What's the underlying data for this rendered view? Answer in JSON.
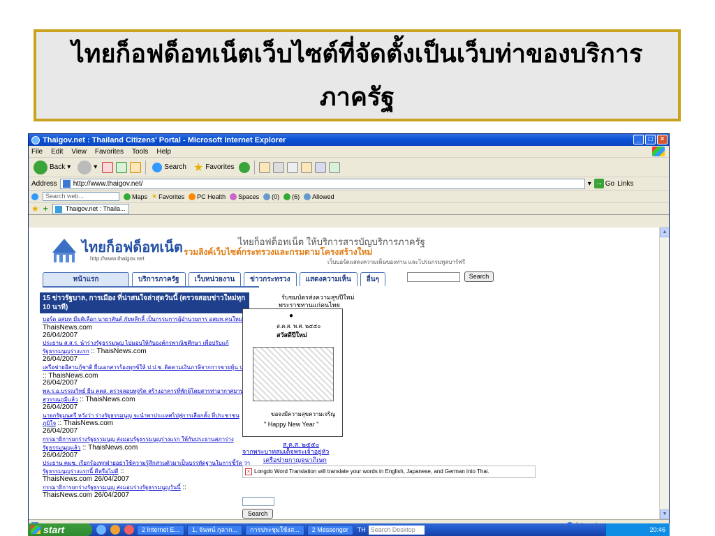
{
  "slide": {
    "title_line1": "ไทยก็อฟด็อทเน็ตเว็บไซต์ที่จัดตั้งเป็นเว็บท่าของบริการ",
    "title_line2": "ภาครัฐ"
  },
  "window": {
    "title": "Thaigov.net : Thailand Citizens' Portal - Microsoft Internet Explorer",
    "menu": [
      "File",
      "Edit",
      "View",
      "Favorites",
      "Tools",
      "Help"
    ],
    "toolbar": {
      "back": "Back",
      "search": "Search",
      "favorites": "Favorites"
    },
    "address": {
      "label": "Address",
      "url": "http://www.thaigov.net/",
      "go": "Go",
      "links": "Links"
    },
    "links_bar": {
      "search_placeholder": "Search web...",
      "maps": "Maps",
      "favorites": "Favorites",
      "pc_health": "PC Health",
      "spaces": "Spaces",
      "mail": "(0)",
      "contacts": "(6)",
      "allowed": "Allowed"
    },
    "tab": {
      "label": "Thaigov.net : Thaila..."
    },
    "status": {
      "zone": "Internet"
    }
  },
  "page": {
    "logo_text": "ไทยก็อฟด็อทเน็ต",
    "logo_url": "http://www.thaigov.net",
    "tagline_1": "ไทยก็อฟด็อทเน็ต ให้บริการสารบัญบริการภาครัฐ",
    "tagline_2": "รวมลิงค์เว็บไซต์กระทรวงและกรมตามโครงสร้างใหม่",
    "tagline_3": "เว็บบอร์ดแสดงความเห็นของท่าน และโปรแกรมทูลบาร์ฟรี",
    "nav": [
      "หน้าแรก",
      "บริการภาครัฐ",
      "เว็บหน่วยงาน",
      "ข่าวกระทรวง",
      "แสดงความเห็น",
      "อื่นๆ"
    ],
    "search_button": "Search",
    "news_header": "15 ข่าวรัฐบาล, การเมือง ที่น่าสนใจล่าสุดวันนี้ (ตรวจสอบข่าวใหม่ทุก 10 นาที)",
    "news": [
      {
        "link": "บอร์ด อสมท มีมติเลือก นายวสันต์ ภัยหลีกลี้ เป็นกรรมการผู้อำนวยการ อสมท.คนใหม่",
        "source": ":: ThaisNews.com",
        "date": "26/04/2007"
      },
      {
        "link": "ประธาน ส.ส.ร. นำร่างรัฐธรรมนูญ ไปมอบให้กับองค์กรพาณิชศึกษา เพื่อปรับแก้รัฐธรรมนูญร่างแรก",
        "source": ":: ThaisNews.com",
        "date": "26/04/2007"
      },
      {
        "link": "เครือข่ายอีสานกู้ชาติ ยื่นเอกสารร้องทุกข์ให้ ป.ป.ช. ติดตามเงินภาษีจากการขายหุ้น ปตท.",
        "source": ":: ThaisNews.com",
        "date": "26/04/2007"
      },
      {
        "link": "พล.ร.อ.บรรณวิทย์ ยืน คตส. ตรวจสอบทุจริต สร้างอาคารที่พักผู้โดยสารท่าอากาศยานสุวรรณภูมิแล้ว",
        "source": ":: ThaisNews.com",
        "date": "26/04/2007"
      },
      {
        "link": "นายกรัฐมนตรี หวังว่า ร่างรัฐธรรมนูญ จะนำพาประเทศไปสู่การเลือกตั้ง ที่ประชาชนภูมิใจ",
        "source": ":: ThaisNews.com",
        "date": "26/04/2007"
      },
      {
        "link": "กรรมาธิการยกร่างรัฐธรรมนูญ ส่งมอบรัฐธรรมนูญร่างแรก ให้กับประธานสภาร่างรัฐธรรมนูญแล้ว",
        "source": ":: ThaisNews.com",
        "date": "26/04/2007"
      },
      {
        "link": "ประธาน คมช. เรียกร้องทุกฝ่ายอย่าใช้ความรู้สึกส่วนตัวมาเป็นบรรทัดฐานในการชี้วัด ว่า รัฐธรรมนูญร่างแรกนี้ ดีหรือไม่ดี",
        "source": "::",
        "date": "ThaisNews.com 26/04/2007"
      },
      {
        "link": "กรรมาธิการยกร่างรัฐธรรมนูญ ส่งมอบร่างรัฐธรรมนูญวันนี้",
        "source": "::",
        "date": "ThaisNews.com 26/04/2007"
      }
    ],
    "card": {
      "caption_1": "รับชมบัตรส่งความสุขปีใหม่",
      "caption_2": "พระราชทานแก่คนไทย",
      "line_1": "ส.ค.ส. พ.ศ. ๒๕๕๐",
      "line_2": "สวัสดีปีใหม่",
      "line_3": "ขอจงมีความสุขความเจริญ",
      "line_4": "\" Happy New Year \"",
      "footer_1": "ส.ค.ส. ๒๕๕๐",
      "footer_2": "จากพระบาทสมเด็จพระเจ้าอยู่หัว",
      "footer_3": "เครือข่ายกาญจนาภิเษก"
    },
    "longdo": "Longdo Word Translation will translate your words in English, Japanese, and German into Thai.",
    "bottom_search": "Search"
  },
  "taskbar": {
    "start": "start",
    "tasks": [
      "2 Internet E...",
      "1. จันทน์ กุลาก...",
      "การประชุมใช้งส...",
      "2 Messenger"
    ],
    "lang": "TH",
    "desktop_search": "Search Desktop",
    "time": "20:46"
  },
  "colors": {
    "title_border": "#c9a320",
    "xp_blue": "#0a4fd4",
    "nav_blue": "#1e3f8c",
    "start_green": "#3c9a3c"
  }
}
